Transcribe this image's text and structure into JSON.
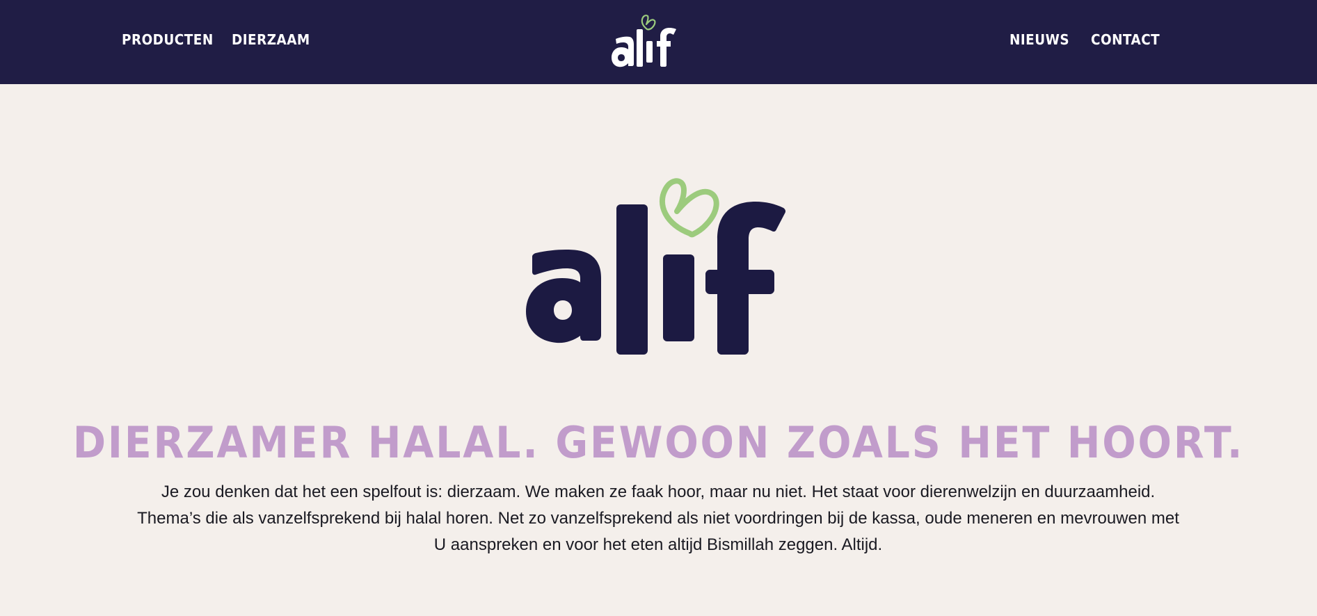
{
  "header": {
    "nav_left": [
      {
        "label": "PRODUCTEN"
      },
      {
        "label": "DIERZAAM"
      }
    ],
    "nav_right": [
      {
        "label": "NIEUWS"
      },
      {
        "label": "CONTACT"
      }
    ],
    "logo_text": "alif"
  },
  "hero": {
    "logo_text": "alif",
    "title": "DIERZAMER HALAL. GEWOON ZOALS HET HOORT.",
    "body": "Je zou denken dat het een spelfout is: dierzaam. We maken ze faak hoor, maar nu niet. Het staat voor dierenwelzijn en duurzaamheid. Thema’s die als vanzelfsprekend bij halal horen. Net zo vanzelfsprekend als niet voordringen bij de kassa, oude meneren en mevrouwen met U aanspreken en voor het eten altijd Bismillah zeggen. Altijd."
  },
  "colors": {
    "navbar_bg": "#201d45",
    "page_bg": "#f4efeb",
    "logo_dark": "#1c1a42",
    "logo_green": "#9ccb7d",
    "title_purple": "#c19ccb"
  },
  "icons": {
    "logo_heart": "heart-icon"
  }
}
